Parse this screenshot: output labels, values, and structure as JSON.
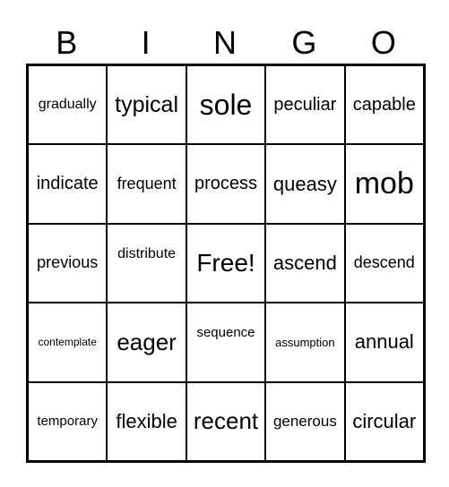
{
  "header": [
    "B",
    "I",
    "N",
    "G",
    "O"
  ],
  "cells": [
    "gradually",
    "typical",
    "sole",
    "peculiar",
    "capable",
    "indicate",
    "frequent",
    "process",
    "queasy",
    "mob",
    "previous",
    "distribute",
    "Free!",
    "ascend",
    "descend",
    "contemplate",
    "eager",
    "sequence",
    "assumption",
    "annual",
    "temporary",
    "flexible",
    "recent",
    "generous",
    "circular"
  ]
}
